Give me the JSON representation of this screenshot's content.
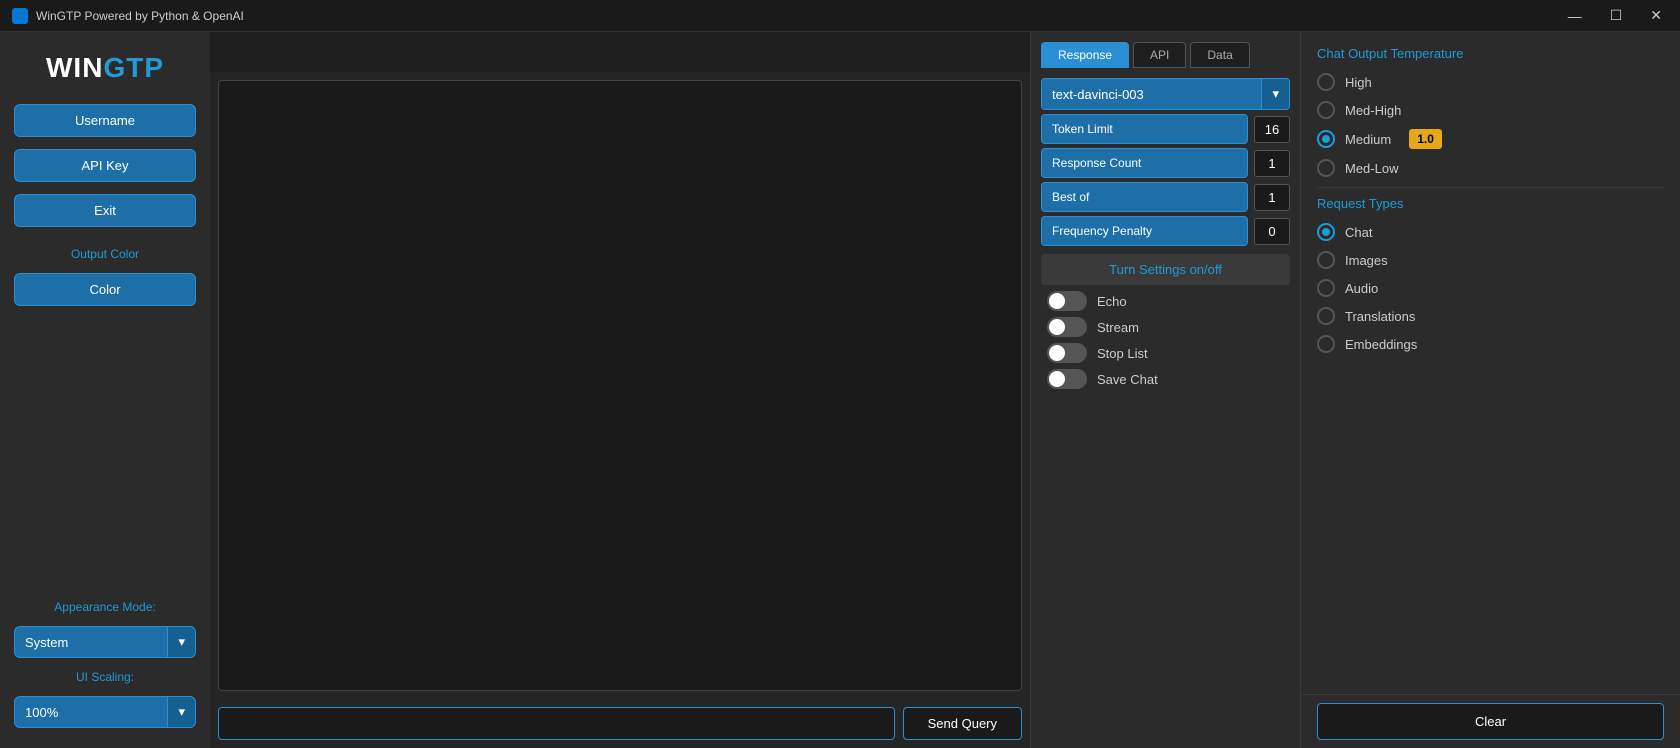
{
  "titleBar": {
    "title": "WinGTP Powered by Python & OpenAI",
    "minimize": "—",
    "maximize": "☐",
    "close": "✕"
  },
  "sidebar": {
    "logo": {
      "white": "WIN",
      "blue": "GTP"
    },
    "buttons": {
      "username": "Username",
      "apiKey": "API Key",
      "exit": "Exit"
    },
    "outputColorLabel": "Output Color",
    "colorBtn": "Color",
    "appearanceModeLabel": "Appearance Mode:",
    "appearanceValue": "System",
    "uiScalingLabel": "UI Scaling:",
    "uiScalingValue": "100%"
  },
  "tabs": {
    "response": "Response",
    "api": "API",
    "data": "Data"
  },
  "model": {
    "value": "text-davinci-003"
  },
  "settings": {
    "tokenLimit": {
      "label": "Token Limit",
      "value": "16"
    },
    "responseCount": {
      "label": "Response Count",
      "value": "1"
    },
    "bestOf": {
      "label": "Best of",
      "value": "1"
    },
    "frequencyPenalty": {
      "label": "Frequency Penalty",
      "value": "0"
    }
  },
  "toggleSection": {
    "header": "Turn Settings on/off",
    "toggles": [
      {
        "label": "Echo",
        "on": false
      },
      {
        "label": "Stream",
        "on": false
      },
      {
        "label": "Stop List",
        "on": false
      },
      {
        "label": "Save Chat",
        "on": false
      }
    ]
  },
  "temperature": {
    "title": "Chat Output Temperature",
    "options": [
      {
        "label": "High",
        "selected": false
      },
      {
        "label": "Med-High",
        "selected": false
      },
      {
        "label": "Medium",
        "selected": true,
        "badge": "1.0"
      },
      {
        "label": "Med-Low",
        "selected": false
      }
    ]
  },
  "requestTypes": {
    "title": "Request Types",
    "options": [
      {
        "label": "Chat",
        "selected": true
      },
      {
        "label": "Images",
        "selected": false
      },
      {
        "label": "Audio",
        "selected": false
      },
      {
        "label": "Translations",
        "selected": false
      },
      {
        "label": "Embeddings",
        "selected": false
      }
    ]
  },
  "queryInput": {
    "placeholder": "",
    "value": ""
  },
  "buttons": {
    "sendQuery": "Send Query",
    "clear": "Clear"
  }
}
